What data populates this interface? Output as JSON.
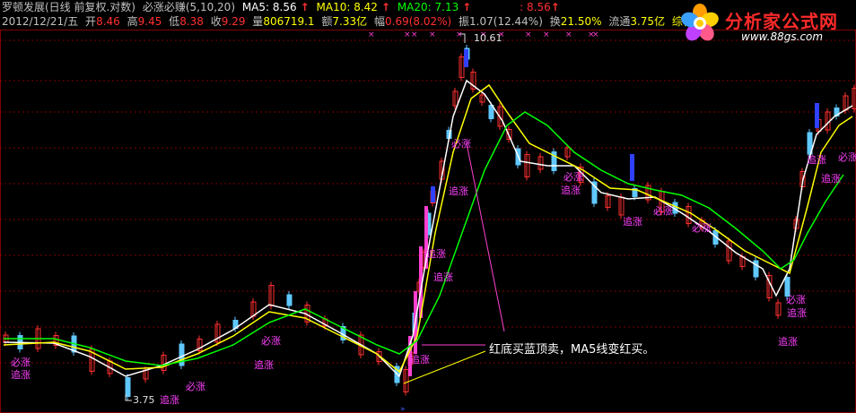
{
  "header": {
    "indicator_title": "罗顿发展(日线 前复权.对数)",
    "formula_name": "必涨必赚(5,10,20)",
    "ma5": {
      "label": "MA5:",
      "value": "8.56",
      "color": "#ffffff"
    },
    "ma10": {
      "label": "MA10:",
      "value": "8.42",
      "color": "#ffff00"
    },
    "ma20": {
      "label": "MA20:",
      "value": "7.13",
      "color": "#00ff00"
    },
    "extra_value": ": 8.56",
    "date": "2012/12/21/五",
    "open": {
      "label": "开",
      "value": "8.46"
    },
    "high": {
      "label": "高",
      "value": "9.45"
    },
    "low": {
      "label": "低",
      "value": "8.38"
    },
    "close": {
      "label": "收",
      "value": "9.29"
    },
    "volume": {
      "label": "量",
      "value": "806719.1"
    },
    "amount": {
      "label": "额",
      "value": "7.33亿"
    },
    "change": {
      "label": "幅",
      "value": "0.69(8.02%)"
    },
    "amplitude": {
      "label": "振",
      "value": "1.07(12.44%)"
    },
    "turnover": {
      "label": "换",
      "value": "21.50%"
    },
    "float": {
      "label": "流通",
      "value": "3.75亿"
    },
    "sector": "综合类"
  },
  "logo": {
    "brand": "分析家公式网",
    "url": "www.88gs.com"
  },
  "annotation": "红底买蓝顶卖，MA5线变红买。",
  "price_labels": {
    "high": "10.61",
    "low": "3.75"
  },
  "signal_labels": {
    "chase": "追涨",
    "must": "必涨"
  },
  "colors": {
    "up": "#ff3030",
    "down": "#60c8ff",
    "magenta": "#ff40d0",
    "ma5": "#ffffff",
    "ma10": "#ffff00",
    "ma20": "#00ff00",
    "grid": "#800000",
    "signal_blue": "#3040ff"
  }
}
